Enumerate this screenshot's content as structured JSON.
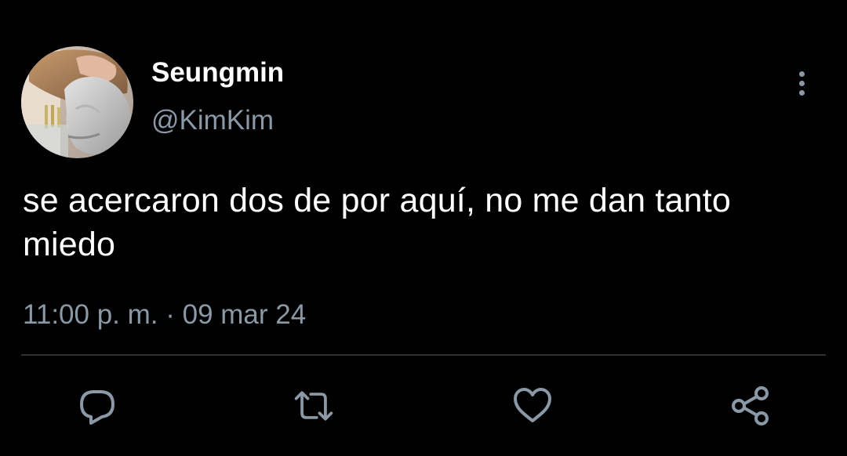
{
  "tweet": {
    "author": {
      "display_name": "Seungmin",
      "handle": "@KimKim"
    },
    "text": "se acercaron dos de por aquí, no me dan tanto miedo",
    "timestamp": "11:00 p. m. · 09 mar 24"
  },
  "icons": {
    "more": "more-vertical-icon",
    "reply": "reply-icon",
    "retweet": "retweet-icon",
    "like": "heart-icon",
    "share": "share-icon"
  },
  "colors": {
    "background": "#000000",
    "primary_text": "#ffffff",
    "secondary_text": "#8b98a5",
    "divider": "#2f3336"
  }
}
